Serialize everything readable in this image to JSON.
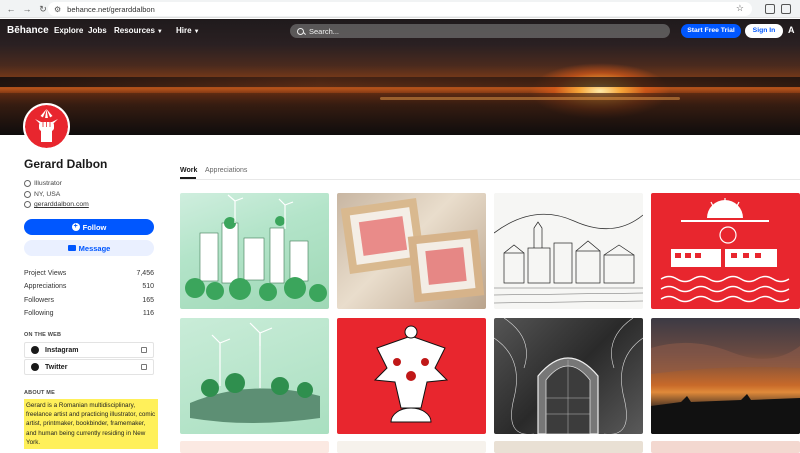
{
  "browser": {
    "url": "behance.net/gerarddalbon"
  },
  "nav": {
    "logo": "Bēhance",
    "links": [
      "Explore",
      "Jobs",
      "Resources",
      "Hire"
    ],
    "search_placeholder": "Search...",
    "trial_button": "Start Free Trial",
    "signin_button": "Sign In",
    "adobe_mark": "A"
  },
  "profile": {
    "name": "Gerard Dalbon",
    "role": "Illustrator",
    "location": "NY, USA",
    "website": "gerarddalbon.com",
    "follow_button": "Follow",
    "message_button": "Message",
    "stats": [
      {
        "label": "Project Views",
        "value": "7,456"
      },
      {
        "label": "Appreciations",
        "value": "510"
      },
      {
        "label": "Followers",
        "value": "165"
      },
      {
        "label": "Following",
        "value": "116"
      }
    ],
    "on_the_web_heading": "ON THE WEB",
    "social": [
      {
        "label": "Instagram",
        "icon": "instagram-icon"
      },
      {
        "label": "Twitter",
        "icon": "twitter-icon"
      }
    ],
    "about_heading": "ABOUT ME",
    "about_text": "Gerard is a Romanian multidisciplinary, freelance artist and practicing illustrator, comic artist, printmaker, bookbinder, framemaker, and human being currently residing in New York."
  },
  "tabs": [
    "Work",
    "Appreciations"
  ],
  "projects": [
    {
      "name": "green-forest-city"
    },
    {
      "name": "red-prints-frames"
    },
    {
      "name": "city-ink-drawing"
    },
    {
      "name": "red-train-poster"
    },
    {
      "name": "green-wind-island"
    },
    {
      "name": "red-eagle-illustration"
    },
    {
      "name": "gothic-door-engraving"
    },
    {
      "name": "sunset-photo"
    }
  ],
  "colors": {
    "accent": "#0057ff",
    "highlight": "#fff05a",
    "red_tile": "#e8262e"
  }
}
